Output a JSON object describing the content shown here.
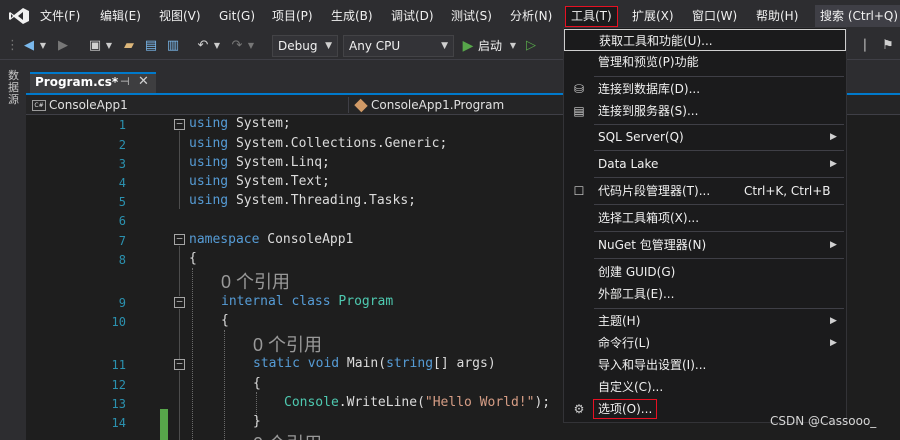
{
  "menubar": {
    "items": [
      "文件(F)",
      "编辑(E)",
      "视图(V)",
      "Git(G)",
      "项目(P)",
      "生成(B)",
      "调试(D)",
      "测试(S)",
      "分析(N)",
      "工具(T)",
      "扩展(X)",
      "窗口(W)",
      "帮助(H)"
    ],
    "search": "搜索 (Ctrl+Q)"
  },
  "toolbar": {
    "config": "Debug",
    "platform": "Any CPU",
    "start": "启动"
  },
  "side_panel": {
    "label": "数据源"
  },
  "tab": {
    "title": "Program.cs*",
    "pin": "⊣",
    "close": "✕"
  },
  "navbar": {
    "project": "ConsoleApp1",
    "cs_badge": "C#",
    "scope": "ConsoleApp1.Program"
  },
  "editor": {
    "line_numbers": [
      "1",
      "2",
      "3",
      "4",
      "5",
      "6",
      "7",
      "8",
      "9",
      "10",
      "11",
      "12",
      "13",
      "14"
    ],
    "lines": {
      "l1_kw": "using",
      "l1_rest": " System;",
      "l2_kw": "using",
      "l2_rest": " System.Collections.Generic;",
      "l3_kw": "using",
      "l3_rest": " System.Linq;",
      "l4_kw": "using",
      "l4_rest": " System.Text;",
      "l5_kw": "using",
      "l5_rest": " System.Threading.Tasks;",
      "l7_kw": "namespace",
      "l7_rest": " ConsoleApp1",
      "l8": "{",
      "l9_kw1": "internal",
      "l9_kw2": " class",
      "l9_ty": " Program",
      "l10": "{",
      "l11_kw1": "static",
      "l11_kw2": " void",
      "l11_rest1": " Main(",
      "l11_kw3": "string",
      "l11_rest2": "[] args)",
      "l12": "{",
      "l13_ty": "Console",
      "l13_rest1": ".WriteLine(",
      "l13_str": "\"Hello World!\"",
      "l13_rest2": ");",
      "l14": "}"
    },
    "refs": "0 个引用"
  },
  "tools_menu": {
    "items": [
      {
        "label": "获取工具和功能(U)...",
        "icon": ""
      },
      {
        "label": "管理和预览(P)功能",
        "icon": ""
      },
      {
        "label": "连接到数据库(D)...",
        "icon": "database-connect-icon"
      },
      {
        "label": "连接到服务器(S)...",
        "icon": "server-connect-icon"
      },
      {
        "label": "SQL Server(Q)",
        "icon": "",
        "submenu": true
      },
      {
        "label": "Data Lake",
        "icon": "",
        "submenu": true
      },
      {
        "label": "代码片段管理器(T)...",
        "icon": "checkbox-icon",
        "shortcut": "Ctrl+K, Ctrl+B"
      },
      {
        "label": "选择工具箱项(X)...",
        "icon": ""
      },
      {
        "label": "NuGet 包管理器(N)",
        "icon": "",
        "submenu": true
      },
      {
        "label": "创建 GUID(G)",
        "icon": ""
      },
      {
        "label": "外部工具(E)...",
        "icon": ""
      },
      {
        "label": "主题(H)",
        "icon": "",
        "submenu": true
      },
      {
        "label": "命令行(L)",
        "icon": "",
        "submenu": true
      },
      {
        "label": "导入和导出设置(I)...",
        "icon": ""
      },
      {
        "label": "自定义(C)...",
        "icon": ""
      },
      {
        "label": "选项(O)...",
        "icon": "gear-icon"
      }
    ]
  },
  "watermark": "CSDN @Cassooo_",
  "colors": {
    "accent": "#007acc",
    "highlight_border": "#e81123",
    "keyword": "#569cd6",
    "type": "#4ec9b0",
    "string": "#d69d85",
    "line_number": "#2b91af",
    "change_bar": "#57a64a"
  }
}
